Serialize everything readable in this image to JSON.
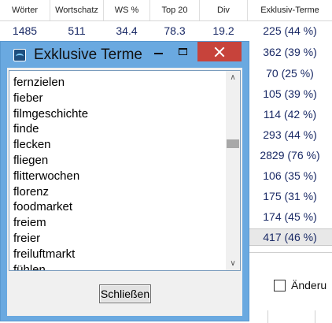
{
  "table": {
    "headers": [
      "Wörter",
      "Wortschatz",
      "WS %",
      "Top 20",
      "Div",
      "Exklusiv-Terme"
    ],
    "first_row": [
      "1485",
      "511",
      "34.4",
      "78.3",
      "19.2",
      "225 (44 %)"
    ],
    "exclusive_terms_column": [
      "362 (39 %)",
      "70 (25 %)",
      "105 (39 %)",
      "114 (42 %)",
      "293 (44 %)",
      "2829 (76 %)",
      "106 (35 %)",
      "175 (31 %)",
      "174 (45 %)",
      "417 (46 %)"
    ]
  },
  "checkbox": {
    "label": "Änderu",
    "checked": false
  },
  "dialog": {
    "title": "Exklusive Terme",
    "items": [
      "fernzielen",
      "fieber",
      "filmgeschichte",
      "finde",
      "flecken",
      "fliegen",
      "flitterwochen",
      "florenz",
      "foodmarket",
      "freiem",
      "freier",
      "freiluftmarkt",
      "fühlen"
    ],
    "close_button_label": "Schließen",
    "scroll_up_glyph": "∧",
    "scroll_down_glyph": "∨"
  }
}
